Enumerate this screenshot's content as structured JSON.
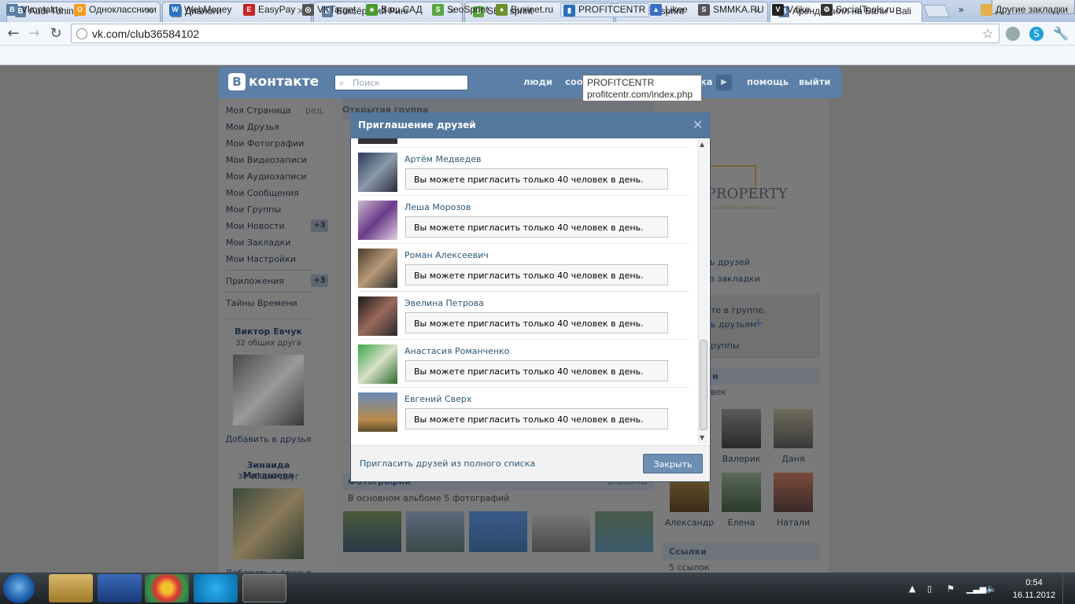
{
  "browser": {
    "tabs": [
      {
        "title": "Audi Tuning",
        "icon": "vk-icon",
        "color": "#5b7fa6"
      },
      {
        "title": "Диалоги",
        "icon": "chat-icon",
        "color": "#5b7fa6"
      },
      {
        "title": "Боксёрский Ринг",
        "icon": "vk-icon",
        "color": "#5b7fa6"
      },
      {
        "title": "SEO sprint",
        "icon": "s-icon",
        "color": "#5aa641"
      },
      {
        "title": "SEO sprint",
        "icon": "s-icon",
        "color": "#5aa641"
      },
      {
        "title": "Аренда вилл на Бали - Bali",
        "icon": "vk-icon",
        "color": "#5b7fa6"
      }
    ],
    "url": "vk.com/club36584102",
    "bookmarks": [
      {
        "label": "Vkontakte",
        "color": "#5b7fa6",
        "glyph": "B"
      },
      {
        "label": "Одноклассники",
        "color": "#f59a1d",
        "glyph": "О"
      },
      {
        "label": "WebMoney",
        "color": "#2a72c4",
        "glyph": "W"
      },
      {
        "label": "EasyPay",
        "color": "#c22",
        "glyph": "E"
      },
      {
        "label": "VKTarget",
        "color": "#555",
        "glyph": "◎"
      },
      {
        "label": "Ваш САД",
        "color": "#4a9a2c",
        "glyph": "♣"
      },
      {
        "label": "SeoSprint",
        "color": "#5aa641",
        "glyph": "S"
      },
      {
        "label": "Buxinet.ru",
        "color": "#6d8f2c",
        "glyph": "♠"
      },
      {
        "label": "PROFITCENTR",
        "color": "#2c6fb4",
        "glyph": "▮"
      },
      {
        "label": "Likee",
        "color": "#3b6fc6",
        "glyph": "👍"
      },
      {
        "label": "SMMKA.RU",
        "color": "#555",
        "glyph": "S"
      },
      {
        "label": "V-like",
        "color": "#222",
        "glyph": "V"
      },
      {
        "label": "SocialTools.ru",
        "color": "#333",
        "glyph": "⚙"
      }
    ],
    "other_bookmarks": "Другие закладки",
    "more": "»"
  },
  "tooltip": {
    "title": "PROFITCENTR",
    "url": "profitcentr.com/index.php"
  },
  "vk": {
    "logo": "контакте",
    "search_placeholder": "Поиск",
    "menu": {
      "people": "люди",
      "communities": "сооб",
      "hidden": "ка",
      "help": "помощь",
      "logout": "выйти"
    },
    "left_menu": [
      {
        "label": "Моя Страница",
        "extra": "ред."
      },
      {
        "label": "Мои Друзья"
      },
      {
        "label": "Мои Фотографии"
      },
      {
        "label": "Мои Видеозаписи"
      },
      {
        "label": "Мои Аудиозаписи"
      },
      {
        "label": "Мои Сообщения"
      },
      {
        "label": "Мои Группы"
      },
      {
        "label": "Мои Новости",
        "count": "+3"
      },
      {
        "label": "Мои Закладки"
      },
      {
        "label": "Мои Настройки"
      }
    ],
    "apps": {
      "label": "Приложения",
      "count": "+3"
    },
    "times": "Тайны Времени",
    "suggest": [
      {
        "name": "Виктор Евчук",
        "common": "32 общих друга",
        "action": "Добавить в друзья"
      },
      {
        "name": "Зинаида Магашева",
        "common": "31 общий друг",
        "action": "Добавить в друзья"
      }
    ],
    "group": {
      "type": "Открытая группа",
      "logo_text": "LI PROPERTY",
      "logo_sub": "ADVISORS FOR RENT AND SALE",
      "right_links": [
        "ь друзей",
        "з закладки"
      ],
      "member_text": "те в группе.",
      "invite_text": "ь друзьям",
      "group_text": "руппы",
      "members_head": "и",
      "members_count": "век",
      "members": [
        "Валерик",
        "Даня",
        "Александр",
        "Елена",
        "Натали"
      ],
      "links_head": "Ссылки",
      "links_count": "5 ссылок",
      "photos_head": "Фотографии",
      "photos_right": "альбомы",
      "photos_caption": "В основном альбоме 5 фотографий"
    }
  },
  "dialog": {
    "title": "Приглашение друзей",
    "friends": [
      {
        "name": "Артём Медведев",
        "button": "Вы можете пригласить только 40 человек в день."
      },
      {
        "name": "Леша Морозов",
        "button": "Вы можете пригласить только 40 человек в день."
      },
      {
        "name": "Роман Алексеевич",
        "button": "Вы можете пригласить только 40 человек в день."
      },
      {
        "name": "Эвелина Петрова",
        "button": "Вы можете пригласить только 40 человек в день."
      },
      {
        "name": "Анастасия Романченко",
        "button": "Вы можете пригласить только 40 человек в день."
      },
      {
        "name": "Евгений Сверх",
        "button": "Вы можете пригласить только 40 человек в день."
      }
    ],
    "invite_full": "Пригласить друзей из полного списка",
    "close": "Закрыть"
  },
  "taskbar": {
    "time": "0:54",
    "date": "16.11.2012"
  }
}
